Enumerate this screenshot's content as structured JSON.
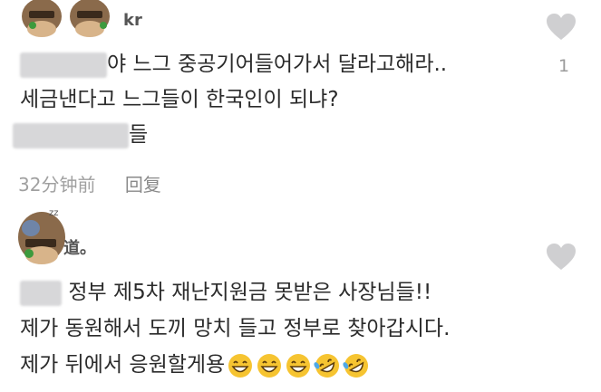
{
  "comment1": {
    "username_tail": "kr",
    "line1": "야 느그 중공기어들어가서 달라고해라..",
    "line2": "세금낸다고 느그들이 한국인이 되냐?",
    "line3_tail": "들",
    "time": "32分钟前",
    "reply_label": "回复",
    "like_count": "1"
  },
  "comment2": {
    "username_tail": "道。",
    "line1": "정부 제5차 재난지원금 못받은 사장님들!!",
    "line2": "제가 동원해서 도끼 망치 들고 정부로 찾아갑시다.",
    "line3": "제가 뒤에서 응원할게용",
    "emojis": [
      "grinning-face",
      "grinning-face",
      "grinning-face",
      "rolling-laughing-face",
      "rolling-laughing-face"
    ]
  },
  "colors": {
    "heart": "#cfcfd1",
    "muted_text": "#a0a0a0",
    "blur": "#d7d7d9",
    "emoji": "#f6c431"
  }
}
